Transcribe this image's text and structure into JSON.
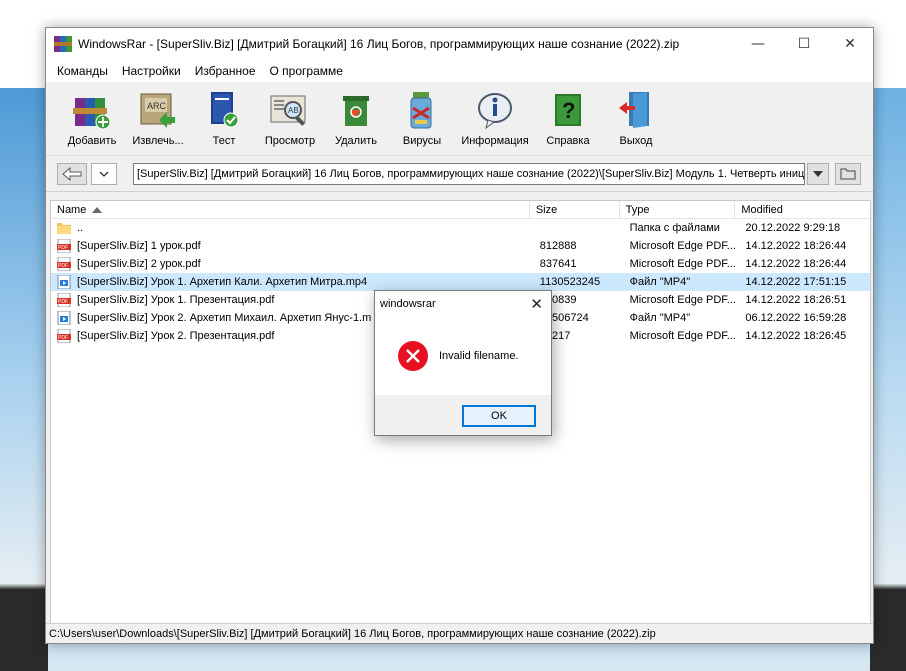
{
  "window": {
    "title": "WindowsRar - [SuperSliv.Biz] [Дмитрий Богацкий] 16 Лиц Богов, программирующих наше сознание (2022).zip",
    "minimize": "—",
    "maximize": "☐",
    "close": "✕"
  },
  "menu": [
    "Команды",
    "Настройки",
    "Избранное",
    "О программе"
  ],
  "toolbar": [
    {
      "label": "Добавить",
      "icon": "add-archive-icon"
    },
    {
      "label": "Извлечь...",
      "icon": "extract-icon"
    },
    {
      "label": "Тест",
      "icon": "test-icon"
    },
    {
      "label": "Просмотр",
      "icon": "view-icon"
    },
    {
      "label": "Удалить",
      "icon": "delete-icon"
    },
    {
      "label": "Вирусы",
      "icon": "virus-scan-icon"
    },
    {
      "label": "Информация",
      "icon": "info-icon"
    },
    {
      "label": "Справка",
      "icon": "help-icon"
    },
    {
      "label": "Выход",
      "icon": "exit-icon"
    }
  ],
  "address": {
    "path": "[SuperSliv.Biz] [Дмитрий Богацкий] 16 Лиц Богов, программирующих наше сознание (2022)\\[SuperSliv.Biz] Модуль 1. Четверть иниц"
  },
  "columns": {
    "name": "Name",
    "size": "Size",
    "type": "Type",
    "modified": "Modified"
  },
  "files": [
    {
      "icon": "folder-icon",
      "name": "..",
      "size": "",
      "type": "Папка с файлами",
      "modified": "20.12.2022 9:29:18",
      "selected": false
    },
    {
      "icon": "pdf-icon",
      "name": "[SuperSliv.Biz] 1 урок.pdf",
      "size": "812888",
      "type": "Microsoft Edge PDF...",
      "modified": "14.12.2022 18:26:44",
      "selected": false
    },
    {
      "icon": "pdf-icon",
      "name": "[SuperSliv.Biz] 2 урок.pdf",
      "size": "837641",
      "type": "Microsoft Edge PDF...",
      "modified": "14.12.2022 18:26:44",
      "selected": false
    },
    {
      "icon": "video-icon",
      "name": "[SuperSliv.Biz] Урок 1. Архетип Кали. Архетип Митра.mp4",
      "size": "1130523245",
      "type": "Файл \"MP4\"",
      "modified": "14.12.2022 17:51:15",
      "selected": true
    },
    {
      "icon": "pdf-icon",
      "name": "[SuperSliv.Biz] Урок 1. Презентация.pdf",
      "size": "130839",
      "type": "Microsoft Edge PDF...",
      "modified": "14.12.2022 18:26:51",
      "selected": false
    },
    {
      "icon": "video-icon",
      "name": "[SuperSliv.Biz] Урок 2. Архетип Михаил. Архетип Янус-1.m",
      "size": "23506724",
      "type": "Файл \"MP4\"",
      "modified": "06.12.2022 16:59:28",
      "selected": false
    },
    {
      "icon": "pdf-icon",
      "name": "[SuperSliv.Biz] Урок 2. Презентация.pdf",
      "size": "77217",
      "type": "Microsoft Edge PDF...",
      "modified": "14.12.2022 18:26:45",
      "selected": false
    }
  ],
  "status": "C:\\Users\\user\\Downloads\\[SuperSliv.Biz] [Дмитрий Богацкий] 16 Лиц Богов, программирующих наше сознание (2022).zip",
  "dialog": {
    "title": "windowsrar",
    "close": "✕",
    "message": "Invalid filename.",
    "ok": "OK"
  },
  "colors": {
    "selection": "#cce8ff",
    "error": "#e81123",
    "ok_border": "#0078d7"
  }
}
